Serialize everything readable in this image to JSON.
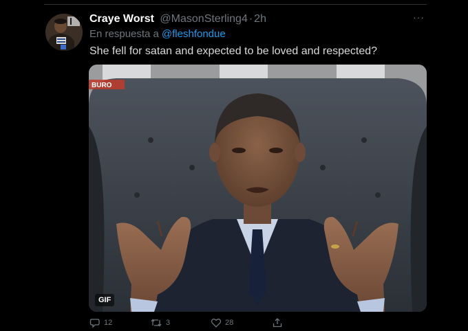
{
  "tweet": {
    "display_name": "Craye Worst",
    "handle": "@MasonSterling4",
    "separator": "·",
    "time": "2h",
    "reply_prefix": "En respuesta a",
    "reply_to": "@fleshfondue",
    "text": "She fell for satan and expected to be loved and respected?",
    "media": {
      "badge": "GIF",
      "overlay_logo": "BURO"
    },
    "actions": {
      "replies": "12",
      "retweets": "3",
      "likes": "28"
    }
  },
  "icons": {
    "more": "more-dots-icon",
    "reply": "comment-bubble-icon",
    "retweet": "retweet-arrows-icon",
    "like": "heart-icon",
    "share": "share-upload-icon"
  },
  "colors": {
    "background": "#000000",
    "primary_text": "#d9d9d9",
    "secondary_text": "#6e767d",
    "link": "#1d9bf0"
  }
}
